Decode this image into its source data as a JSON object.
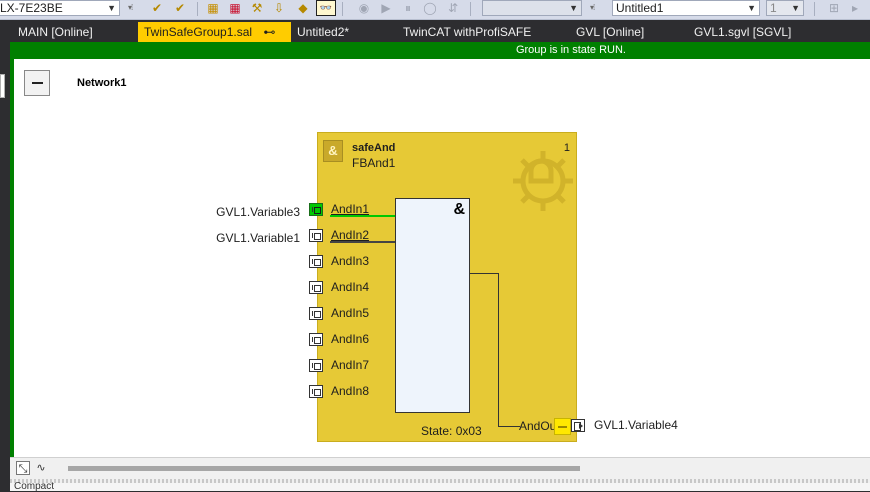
{
  "toolbar": {
    "target_combo": "LX-7E23BE",
    "config_combo": "Untitled1",
    "number_combo": "1"
  },
  "tabs": [
    {
      "label": "MAIN [Online]",
      "active": false
    },
    {
      "label": "TwinSafeGroup1.sal",
      "active": true,
      "pin": "⊷",
      "close": "✕"
    },
    {
      "label": "Untitled2*",
      "active": false
    },
    {
      "label": "TwinCAT withProfiSAFE",
      "active": false
    },
    {
      "label": "GVL [Online]",
      "active": false
    },
    {
      "label": "GVL1.sgvl [SGVL]",
      "active": false
    }
  ],
  "editor": {
    "status": "Group is in state RUN.",
    "network_label": "Network1"
  },
  "fb": {
    "icon_label": "&",
    "type": "safeAnd",
    "instance": "FBAnd1",
    "number": "1",
    "operator": "&",
    "state": "State: 0x03",
    "inputs": [
      {
        "name": "AndIn1",
        "var": "GVL1.Variable3",
        "active": true,
        "connected": true
      },
      {
        "name": "AndIn2",
        "var": "GVL1.Variable1",
        "active": false,
        "connected": true
      },
      {
        "name": "AndIn3",
        "var": "",
        "active": false,
        "connected": false
      },
      {
        "name": "AndIn4",
        "var": "",
        "active": false,
        "connected": false
      },
      {
        "name": "AndIn5",
        "var": "",
        "active": false,
        "connected": false
      },
      {
        "name": "AndIn6",
        "var": "",
        "active": false,
        "connected": false
      },
      {
        "name": "AndIn7",
        "var": "",
        "active": false,
        "connected": false
      },
      {
        "name": "AndIn8",
        "var": "",
        "active": false,
        "connected": false
      }
    ],
    "output": {
      "name": "AndOut",
      "var": "GVL1.Variable4"
    }
  },
  "bottom": {
    "zoom_icon": "⤡",
    "mode_icon": "∿",
    "panel_tab": "Compact"
  },
  "colors": {
    "status_green": "#008000",
    "fb_yellow": "#e6c936",
    "active_tab": "#ffcc00",
    "signal_green": "#00c800"
  }
}
